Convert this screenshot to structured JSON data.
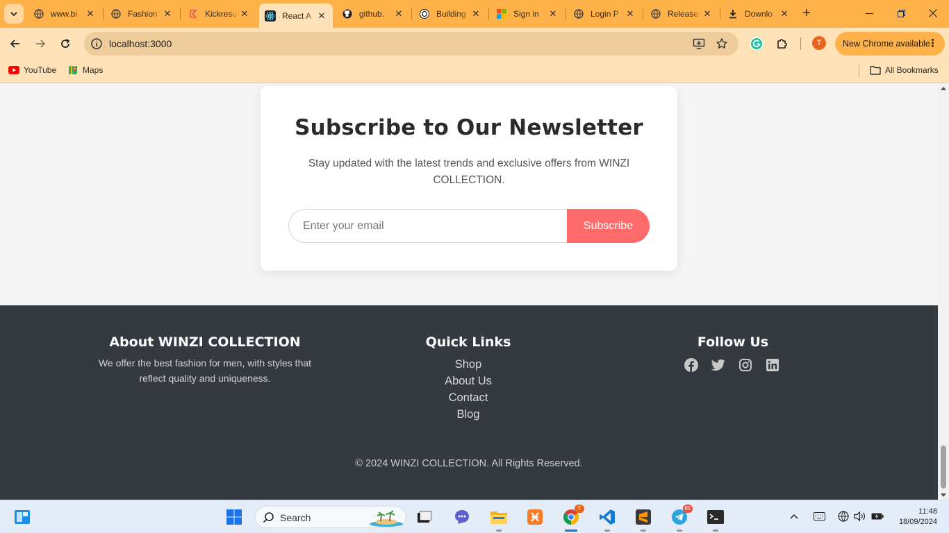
{
  "browser": {
    "tabs": [
      {
        "title": "www.bi",
        "favicon": "globe-icon"
      },
      {
        "title": "Fashion",
        "favicon": "globe-icon"
      },
      {
        "title": "Kickresu",
        "favicon": "kickresume-icon"
      },
      {
        "title": "React A",
        "favicon": "react-icon"
      },
      {
        "title": "github.",
        "favicon": "github-icon"
      },
      {
        "title": "Building",
        "favicon": "openai-icon"
      },
      {
        "title": "Sign in",
        "favicon": "microsoft-icon"
      },
      {
        "title": "Login P",
        "favicon": "globe-icon"
      },
      {
        "title": "Release",
        "favicon": "globe-icon"
      },
      {
        "title": "Downlo",
        "favicon": "download-icon"
      }
    ],
    "active_tab_index": 3,
    "address": "localhost:3000",
    "update_label": "New Chrome available",
    "profile_initial": "T",
    "bookmarks": [
      {
        "label": "YouTube",
        "icon": "youtube-icon"
      },
      {
        "label": "Maps",
        "icon": "maps-icon"
      }
    ],
    "all_bookmarks_label": "All Bookmarks"
  },
  "newsletter": {
    "title": "Subscribe to Our Newsletter",
    "text": "Stay updated with the latest trends and exclusive offers from WINZI COLLECTION.",
    "email_placeholder": "Enter your email",
    "button_label": "Subscribe"
  },
  "footer": {
    "about": {
      "heading": "About WINZI COLLECTION",
      "text": "We offer the best fashion for men, with styles that reflect quality and uniqueness."
    },
    "quick_links": {
      "heading": "Quick Links",
      "items": [
        "Shop",
        "About Us",
        "Contact",
        "Blog"
      ]
    },
    "follow": {
      "heading": "Follow Us",
      "icons": [
        "facebook-icon",
        "twitter-icon",
        "instagram-icon",
        "linkedin-icon"
      ]
    },
    "copyright": "© 2024 WINZI COLLECTION. All Rights Reserved."
  },
  "taskbar": {
    "search_label": "Search",
    "telegram_badge": "85",
    "chrome_badge": "T",
    "time": "11:48",
    "date": "18/09/2024"
  },
  "colors": {
    "tab_strip": "#ffb14a",
    "toolbar": "#ffe2b8",
    "accent_button": "#ff6b6b",
    "footer_bg": "#343a40"
  }
}
